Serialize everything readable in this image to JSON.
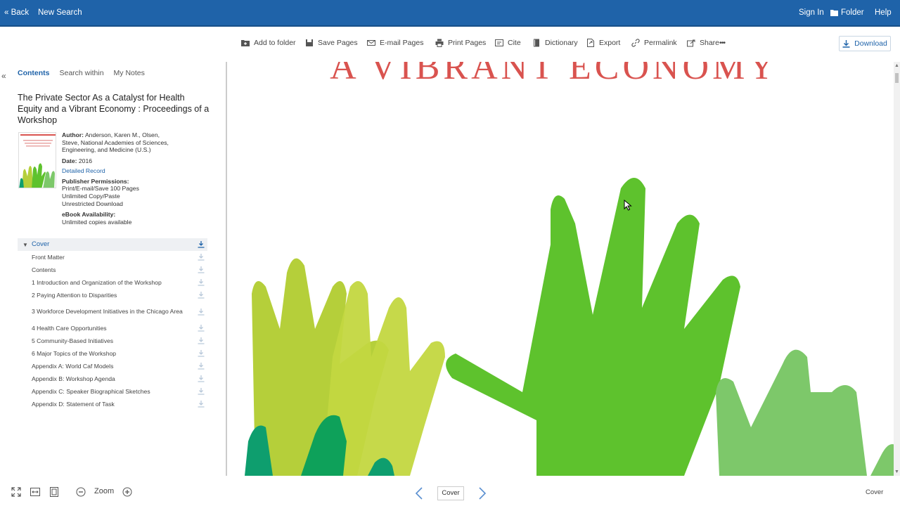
{
  "topbar": {
    "back": "« Back",
    "new_search": "New Search",
    "sign_in": "Sign In",
    "folder": "Folder",
    "help": "Help"
  },
  "toolbar": {
    "add_to_folder": "Add to folder",
    "save_pages": "Save Pages",
    "email_pages": "E-mail Pages",
    "print_pages": "Print Pages",
    "cite": "Cite",
    "dictionary": "Dictionary",
    "export": "Export",
    "permalink": "Permalink",
    "share": "Share",
    "download": "Download"
  },
  "sidebar": {
    "collapse": "«",
    "tabs": [
      "Contents",
      "Search within",
      "My Notes"
    ],
    "book": {
      "title": "The Private Sector As a Catalyst for Health Equity and a Vibrant Economy : Proceedings of a Workshop",
      "author_label": "Author:",
      "author": "Anderson, Karen M., Olsen, Steve, National Academies of Sciences, Engineering, and Medicine (U.S.)",
      "date_label": "Date:",
      "date": "2016",
      "detailed_record": "Detailed Record",
      "permissions_label": "Publisher Permissions:",
      "permissions": [
        "Print/E-mail/Save 100 Pages",
        "Unlimited Copy/Paste",
        "Unrestricted Download"
      ],
      "availability_label": "eBook Availability:",
      "availability": "Unlimited copies available"
    },
    "toc": {
      "current": "Cover",
      "items": [
        "Front Matter",
        "Contents",
        "1 Introduction and Organization of the Workshop",
        "2 Paying Attention to Disparities",
        "3 Workforce Development Initiatives in the Chicago Area",
        "4 Health Care Opportunities",
        "5 Community-Based Initiatives",
        "6 Major Topics of the Workshop",
        "Appendix A: World Caf Models",
        "Appendix B: Workshop Agenda",
        "Appendix C: Speaker Biographical Sketches",
        "Appendix D: Statement of Task"
      ]
    }
  },
  "viewer": {
    "cover_heading": "A VIBRANT ECONOMY"
  },
  "bottom": {
    "zoom": "Zoom",
    "page": "Cover",
    "current_section": "Cover"
  },
  "colors": {
    "brand": "#1f63a9",
    "cover_title": "#d9534f",
    "hand_yellow": "#b5cf3a",
    "hand_green": "#5ec22d",
    "hand_light": "#7dc86a",
    "hand_teal": "#0e9e6e"
  }
}
